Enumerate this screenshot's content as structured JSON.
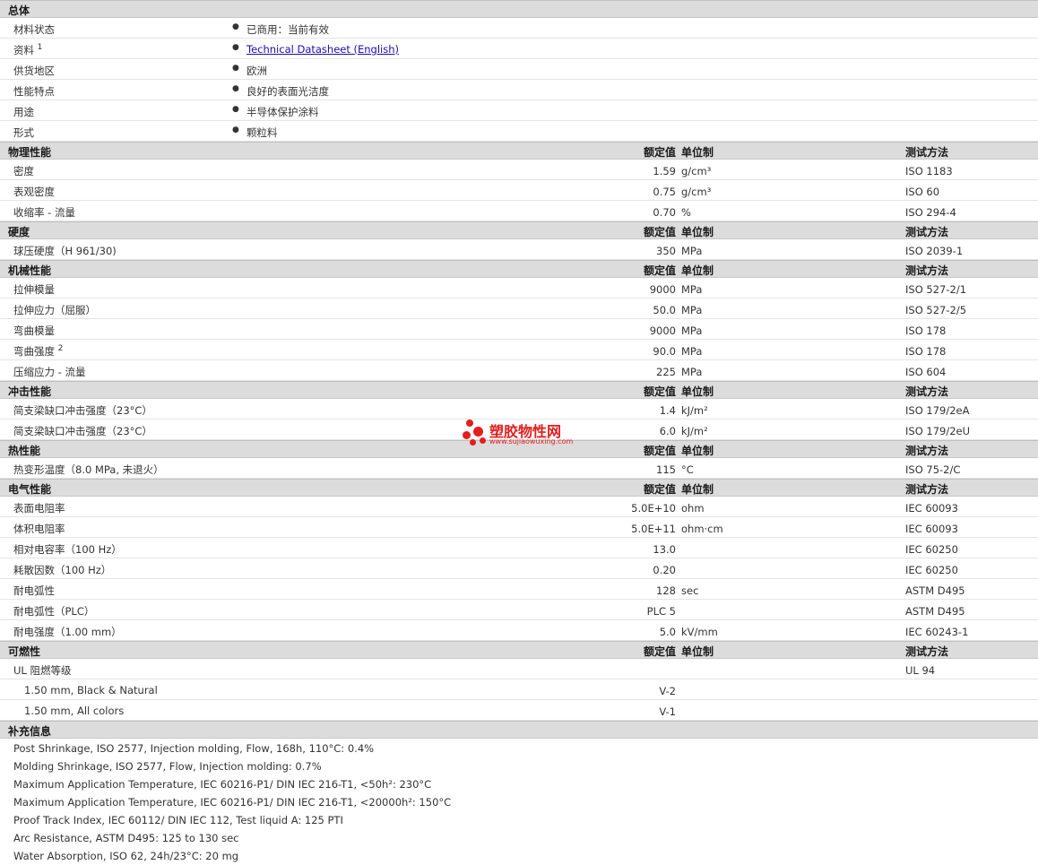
{
  "general": {
    "title": "总体",
    "rows": [
      {
        "label": "材料状态",
        "text": "已商用：当前有效"
      },
      {
        "label": "资料",
        "sup": "1",
        "text": "Technical Datasheet (English)",
        "link": true
      },
      {
        "label": "供货地区",
        "text": "欧洲"
      },
      {
        "label": "性能特点",
        "text": "良好的表面光洁度"
      },
      {
        "label": "用途",
        "text": "半导体保护涂料"
      },
      {
        "label": "形式",
        "text": "颗粒料"
      }
    ]
  },
  "col_headers": {
    "value": "额定值",
    "unit": "单位制",
    "method": "测试方法"
  },
  "sections": [
    {
      "title": "物理性能",
      "rows": [
        {
          "label": "密度",
          "value": "1.59",
          "unit": "g/cm³",
          "method": "ISO 1183"
        },
        {
          "label": "表观密度",
          "value": "0.75",
          "unit": "g/cm³",
          "method": "ISO 60"
        },
        {
          "label": "收缩率 - 流量",
          "value": "0.70",
          "unit": "%",
          "method": "ISO 294-4"
        }
      ]
    },
    {
      "title": "硬度",
      "rows": [
        {
          "label": "球压硬度（H 961/30)",
          "value": "350",
          "unit": "MPa",
          "method": "ISO 2039-1"
        }
      ]
    },
    {
      "title": "机械性能",
      "rows": [
        {
          "label": "拉伸模量",
          "value": "9000",
          "unit": "MPa",
          "method": "ISO 527-2/1"
        },
        {
          "label": "拉伸应力（屈服）",
          "value": "50.0",
          "unit": "MPa",
          "method": "ISO 527-2/5"
        },
        {
          "label": "弯曲模量",
          "value": "9000",
          "unit": "MPa",
          "method": "ISO 178"
        },
        {
          "label": "弯曲强度",
          "sup": "2",
          "value": "90.0",
          "unit": "MPa",
          "method": "ISO 178"
        },
        {
          "label": "压缩应力 - 流量",
          "value": "225",
          "unit": "MPa",
          "method": "ISO 604"
        }
      ]
    },
    {
      "title": "冲击性能",
      "rows": [
        {
          "label": "简支梁缺口冲击强度（23°C）",
          "value": "1.4",
          "unit": "kJ/m²",
          "method": "ISO 179/2eA"
        },
        {
          "label": "简支梁缺口冲击强度（23°C）",
          "value": "6.0",
          "unit": "kJ/m²",
          "method": "ISO 179/2eU"
        }
      ]
    },
    {
      "title": "热性能",
      "rows": [
        {
          "label": "热变形温度（8.0 MPa, 未退火）",
          "value": "115",
          "unit": "°C",
          "method": "ISO 75-2/C"
        }
      ]
    },
    {
      "title": "电气性能",
      "rows": [
        {
          "label": "表面电阻率",
          "value": "5.0E+10",
          "unit": "ohm",
          "method": "IEC 60093"
        },
        {
          "label": "体积电阻率",
          "value": "5.0E+11",
          "unit": "ohm·cm",
          "method": "IEC 60093"
        },
        {
          "label": "相对电容率（100 Hz）",
          "value": "13.0",
          "unit": "",
          "method": "IEC 60250"
        },
        {
          "label": "耗散因数（100 Hz）",
          "value": "0.20",
          "unit": "",
          "method": "IEC 60250"
        },
        {
          "label": "耐电弧性",
          "value": "128",
          "unit": "sec",
          "method": "ASTM D495"
        },
        {
          "label": "耐电弧性（PLC）",
          "value": "PLC 5",
          "unit": "",
          "method": "ASTM D495"
        },
        {
          "label": "耐电强度（1.00 mm）",
          "value": "5.0",
          "unit": "kV/mm",
          "method": "IEC 60243-1"
        }
      ]
    },
    {
      "title": "可燃性",
      "rows": [
        {
          "label": "UL 阻燃等级",
          "value": "",
          "unit": "",
          "method": "UL 94"
        },
        {
          "label": "1.50 mm, Black & Natural",
          "indent": true,
          "value": "V-2",
          "unit": "",
          "method": ""
        },
        {
          "label": "1.50 mm, All colors",
          "indent": true,
          "value": "V-1",
          "unit": "",
          "method": ""
        }
      ]
    }
  ],
  "supplement": {
    "title": "补充信息",
    "lines": [
      "Post Shrinkage, ISO 2577, Injection molding, Flow, 168h, 110°C: 0.4%",
      "Molding Shrinkage, ISO 2577, Flow, Injection molding: 0.7%",
      "Maximum Application Temperature, IEC 60216-P1/ DIN IEC 216-T1, <50h²: 230°C",
      "Maximum Application Temperature, IEC 60216-P1/ DIN IEC 216-T1, <20000h²: 150°C",
      "Proof Track Index, IEC 60112/ DIN IEC 112, Test liquid A: 125 PTI",
      "Arc Resistance, ASTM D495: 125 to 130 sec",
      "Water Absorption, ISO 62, 24h/23°C: 20 mg"
    ]
  },
  "watermark": {
    "name": "塑胶物性网",
    "url": "www.sujiaowuxing.com",
    "color": "#e41d1d"
  }
}
